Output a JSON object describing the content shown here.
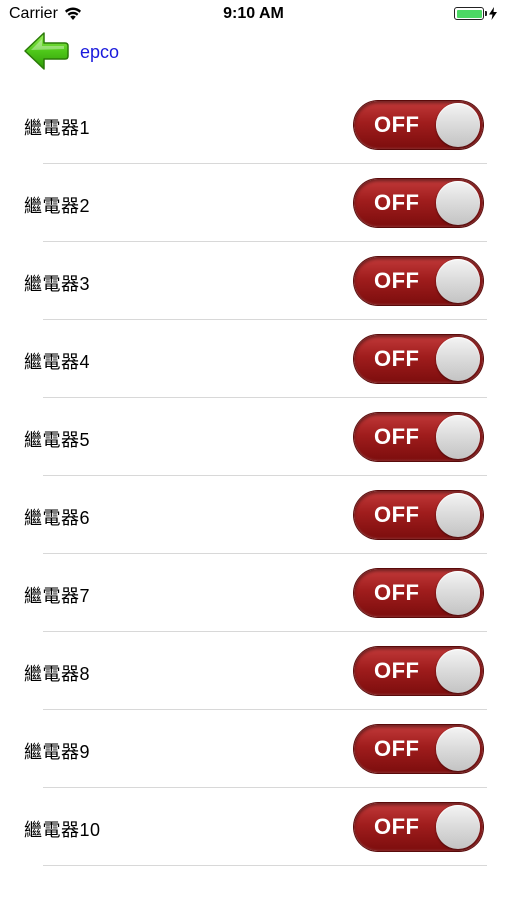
{
  "status_bar": {
    "carrier": "Carrier",
    "time": "9:10 AM",
    "battery_level": 1.0,
    "icons": [
      "wifi-icon",
      "battery-icon",
      "charging-bolt-icon"
    ]
  },
  "nav": {
    "back_icon": "green-back-arrow-icon",
    "title": "epco"
  },
  "relays": [
    {
      "label": "繼電器1",
      "state": "OFF"
    },
    {
      "label": "繼電器2",
      "state": "OFF"
    },
    {
      "label": "繼電器3",
      "state": "OFF"
    },
    {
      "label": "繼電器4",
      "state": "OFF"
    },
    {
      "label": "繼電器5",
      "state": "OFF"
    },
    {
      "label": "繼電器6",
      "state": "OFF"
    },
    {
      "label": "繼電器7",
      "state": "OFF"
    },
    {
      "label": "繼電器8",
      "state": "OFF"
    },
    {
      "label": "繼電器9",
      "state": "OFF"
    },
    {
      "label": "繼電器10",
      "state": "OFF"
    }
  ],
  "colors": {
    "toggle_off": "#a01d1d",
    "title_link": "#1a1adc",
    "back_arrow": "#3cbf0f",
    "battery": "#4cd964"
  }
}
